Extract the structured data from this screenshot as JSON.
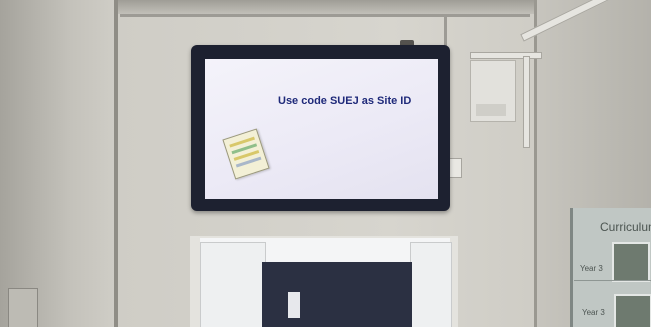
{
  "screen": {
    "message": "Use code SUEJ as Site ID"
  },
  "board": {
    "heading": "Curriculum",
    "labels": [
      "Year 3",
      "Year 3"
    ]
  }
}
